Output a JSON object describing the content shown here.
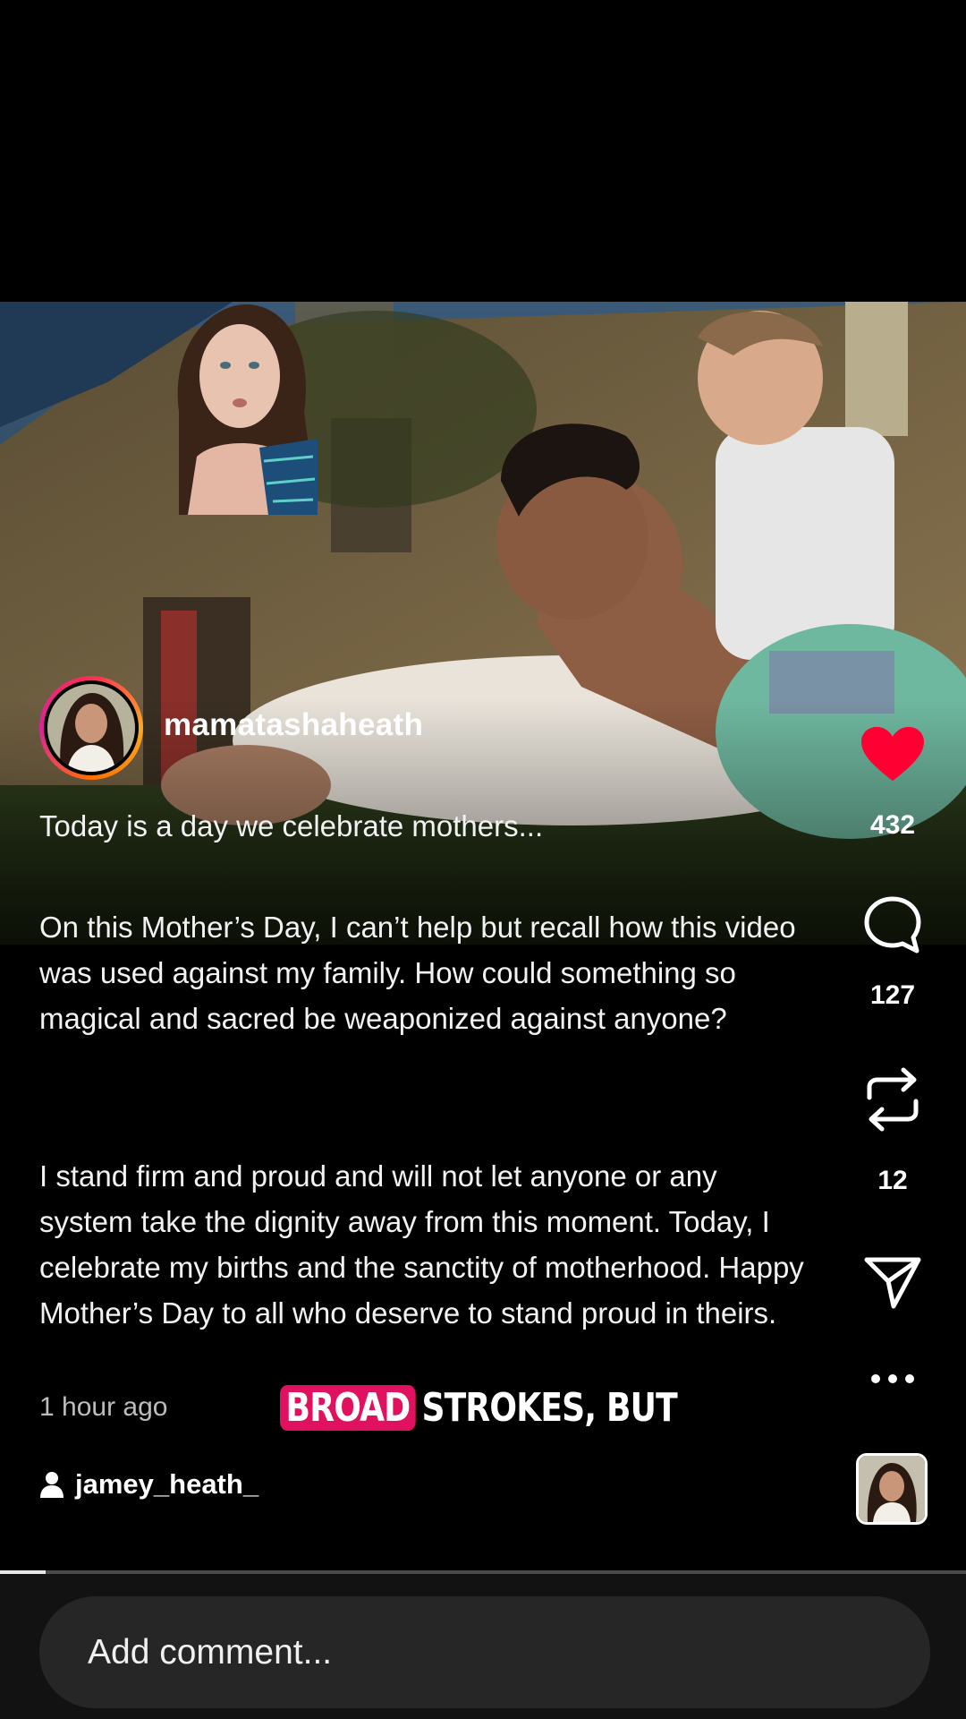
{
  "post": {
    "username": "mamatashaheath",
    "caption_line1": "Today is a day we celebrate mothers...",
    "caption_para1": "On this Mother’s Day, I can’t help but recall how this video was used against my family.  How could something so magical and sacred be weaponized against anyone?",
    "caption_para2": "I stand firm and proud and will not let anyone or any system take the dignity away from this moment.  Today, I celebrate my births and the sanctity of motherhood.  Happy Mother’s Day to all who deserve to stand proud in theirs.",
    "timestamp": "1 hour ago",
    "audio_user": "jamey_heath_"
  },
  "subtitle": {
    "highlight": "BROAD",
    "rest": "STROKES, BUT"
  },
  "actions": {
    "likes": "432",
    "comments": "127",
    "reposts": "12",
    "liked": true,
    "like_color": "#ff0033"
  },
  "icons": {
    "like": "heart-icon",
    "comment": "speech-bubble-icon",
    "repost": "repost-arrows-icon",
    "share": "paper-plane-icon",
    "more": "more-dots-icon",
    "audio": "person-icon"
  },
  "progress": {
    "fraction": 0.047
  },
  "comment_box": {
    "placeholder": "Add comment..."
  }
}
